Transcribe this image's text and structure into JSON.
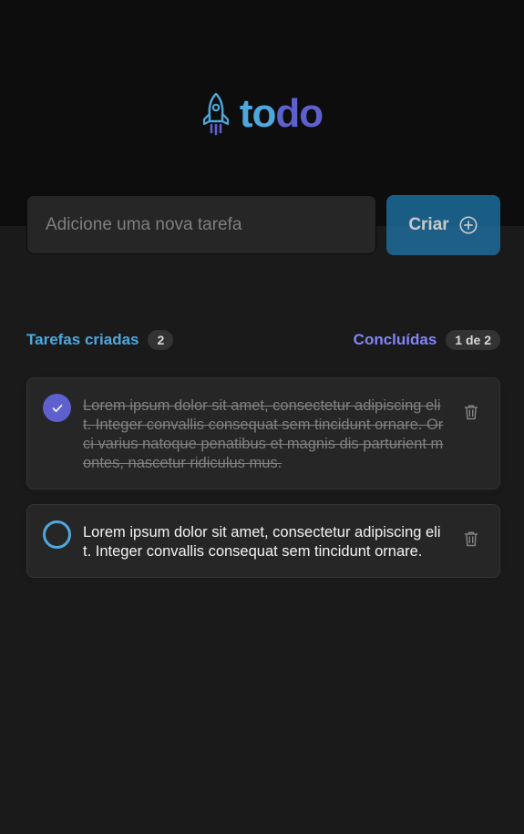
{
  "logo": {
    "part1": "to",
    "part2": "do",
    "icon": "rocket-icon"
  },
  "create": {
    "placeholder": "Adicione uma nova tarefa",
    "value": "",
    "button_label": "Criar",
    "button_icon": "plus-circle-icon"
  },
  "counters": {
    "created_label": "Tarefas criadas",
    "created_count": "2",
    "done_label": "Concluídas",
    "done_count": "1 de 2"
  },
  "tasks": [
    {
      "text": "Lorem ipsum dolor sit amet, consectetur adipiscing elit. Integer convallis consequat sem tincidunt ornare. Orci varius natoque penatibus et magnis dis parturient montes, nascetur ridiculus mus.",
      "done": true
    },
    {
      "text": "Lorem ipsum dolor sit amet, consectetur adipiscing elit. Integer convallis consequat sem tincidunt ornare.",
      "done": false
    }
  ],
  "colors": {
    "blue": "#4ea8de",
    "blue_dark": "#1e6f9f",
    "purple": "#5e60ce",
    "purple_light": "#8284fa",
    "header_bg": "#0d0d0d",
    "body_bg": "#1a1a1a",
    "card_bg": "#262626"
  }
}
